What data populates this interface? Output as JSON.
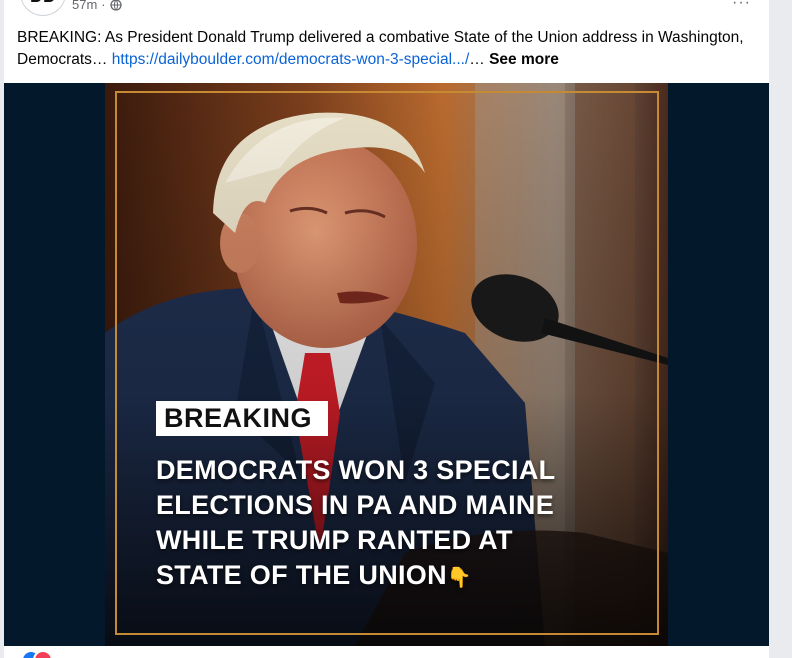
{
  "post": {
    "avatar_text": "DD",
    "timestamp": "57m",
    "separator": "·",
    "privacy_icon": "globe-icon",
    "more_icon": "more-options-icon",
    "text": "BREAKING: As President Donald Trump delivered a combative State of the Union address in Washington, Democrats…",
    "link_text": "https://dailyboulder.com/democrats-won-3-special.../",
    "ellipsis": "…",
    "see_more": "See more"
  },
  "image": {
    "tag": "BREAKING",
    "headline_lines": [
      "DEMOCRATS WON 3 SPECIAL",
      "ELECTIONS IN PA AND MAINE",
      "WHILE TRUMP RANTED AT",
      "STATE OF THE UNION"
    ],
    "emoji": "👇"
  },
  "reactions": {
    "icons": [
      "like-icon",
      "love-icon"
    ]
  },
  "colors": {
    "link": "#0a63d6",
    "media_background": "#03182b",
    "frame": "#c58a33",
    "tie": "#d81f2a",
    "suit": "#1f2f4f"
  }
}
